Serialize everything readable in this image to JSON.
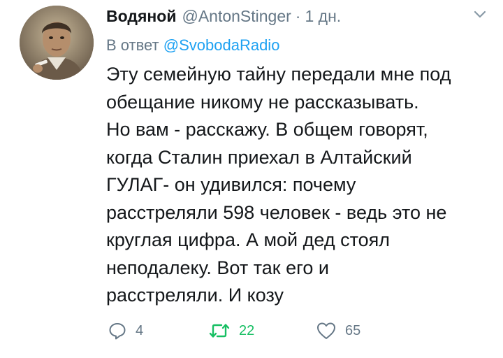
{
  "tweet": {
    "author_name": "Водяной",
    "handle": "@AntonStinger",
    "separator": "·",
    "time": "1 дн.",
    "reply_prefix": "В ответ",
    "reply_mention": "@SvobodaRadio",
    "body_lines": [
      "Эту семейную тайну передали мне под",
      "обещание никому не рассказывать.",
      "Но вам - расскажу. В общем говорят,",
      "когда Сталин приехал в Алтайский",
      "ГУЛАГ- он удивился: почему",
      "расстреляли 598 человек - ведь это не",
      "круглая цифра. А мой дед стоял",
      "неподалеку. Вот так его и",
      "расстреляли. И козу"
    ],
    "actions": {
      "replies": "4",
      "retweets": "22",
      "likes": "65"
    }
  },
  "colors": {
    "text": "#14171a",
    "secondary": "#657786",
    "link": "#1da1f2",
    "retweet_active": "#17bf63"
  },
  "icons": [
    "avatar",
    "chevron-down-icon",
    "reply-icon",
    "retweet-icon",
    "like-icon"
  ]
}
